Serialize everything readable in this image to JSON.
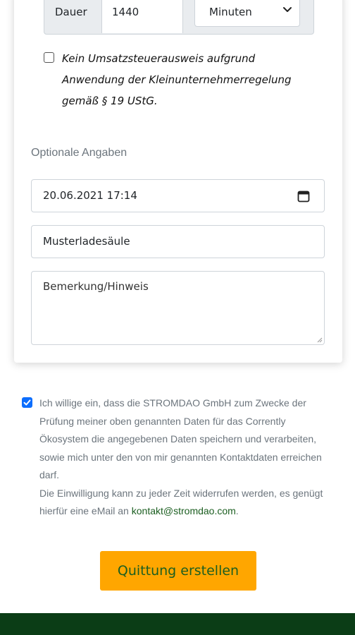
{
  "duration": {
    "label": "Dauer",
    "value": "1440",
    "unit": "Minuten"
  },
  "tax_checkbox": {
    "checked": false,
    "label": "Kein Umsatzsteuerausweis aufgrund Anwendung der Kleinunternehmerregelung gemäß § 19 UStG."
  },
  "optional": {
    "heading": "Optionale Angaben",
    "datetime_value": "20.06.2021 17:14",
    "station_value": "Musterladesäule",
    "note_placeholder": "Bemerkung/Hinweis"
  },
  "consent": {
    "checked": true,
    "text": "Ich willige ein, dass die STROMDAO GmbH zum Zwecke der Prüfung meiner oben genannten Daten für das Corrently Ökosystem die angegebenen Daten speichern und verarbeiten, sowie mich unter den von mir genannten Kontaktdaten erreichen darf.",
    "revoke_text": "Die Einwilligung kann zu jeder Zeit widerrufen werden, es genügt hierfür eine eMail an",
    "email": "kontakt@stromdao.com",
    "end": "."
  },
  "submit_label": "Quittung erstellen",
  "colors": {
    "accent": "#ffa600",
    "brand_green": "#1b5e20",
    "footer": "#0b3d16",
    "checkbox": "#0d6efd"
  },
  "icons": [
    "chevron-down-icon",
    "calendar-icon",
    "checkmark-icon",
    "resize-handle-icon"
  ]
}
